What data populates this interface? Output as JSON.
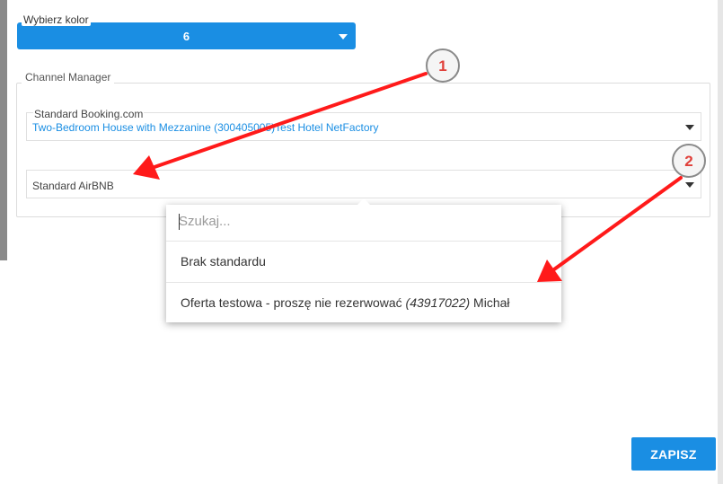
{
  "color_select": {
    "label": "Wybierz kolor",
    "value": "6",
    "accent": "#1a8ee3"
  },
  "channel_manager": {
    "legend": "Channel Manager",
    "booking": {
      "label": "Standard Booking.com",
      "value": "Two-Bedroom House with Mezzanine (300405005)Test Hotel NetFactory"
    },
    "airbnb": {
      "value": "Standard AirBNB"
    }
  },
  "dropdown": {
    "search_placeholder": "Szukaj...",
    "options": [
      {
        "label": "Brak standardu"
      },
      {
        "prefix": "Oferta testowa - proszę nie rezerwować ",
        "id": "(43917022)",
        "suffix": " Michał"
      }
    ]
  },
  "save_label": "ZAPISZ",
  "annotations": {
    "badge_1": "1",
    "badge_2": "2",
    "arrow_color": "#ff1a1a"
  }
}
